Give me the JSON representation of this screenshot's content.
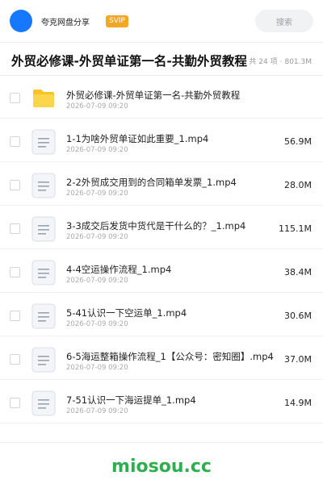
{
  "header": {
    "avatar_icon": "user-avatar-icon",
    "brand": "夸克网盘分享",
    "vip_badge": "SVIP",
    "search_placeholder": "搜索"
  },
  "folder": {
    "title": "外贸必修课-外贸单证第一名-共勤外贸教程",
    "count_text": "共 24 项",
    "separator": "·",
    "total_size": "801.3M"
  },
  "files": [
    {
      "icon": "folder-icon",
      "name": "外贸必修课-外贸单证第一名-共勤外贸教程",
      "date": "2026-07-09 09:20",
      "size": ""
    },
    {
      "icon": "file-icon",
      "name": "1-1为啥外贸单证如此重要_1.mp4",
      "date": "2026-07-09 09:20",
      "size": "56.9M"
    },
    {
      "icon": "file-icon",
      "name": "2-2外贸成交用到的合同箱单发票_1.mp4",
      "date": "2026-07-09 09:20",
      "size": "28.0M"
    },
    {
      "icon": "file-icon",
      "name": "3-3成交后发货中货代是干什么的？_1.mp4",
      "date": "2026-07-09 09:20",
      "size": "115.1M"
    },
    {
      "icon": "file-icon",
      "name": "4-4空运操作流程_1.mp4",
      "date": "2026-07-09 09:20",
      "size": "38.4M"
    },
    {
      "icon": "file-icon",
      "name": "5-41认识一下空运单_1.mp4",
      "date": "2026-07-09 09:20",
      "size": "30.6M"
    },
    {
      "icon": "file-icon",
      "name": "6-5海运整箱操作流程_1【公众号：密知圈】.mp4",
      "date": "2026-07-09 09:20",
      "size": "37.0M"
    },
    {
      "icon": "file-icon",
      "name": "7-51认识一下海运提单_1.mp4",
      "date": "2026-07-09 09:20",
      "size": "14.9M"
    }
  ],
  "watermark": "miosou.cc",
  "colors": {
    "avatar": "#1677ff",
    "vip": "#f5a623",
    "folder": "#f7c325",
    "watermark": "#2eaf4f"
  }
}
